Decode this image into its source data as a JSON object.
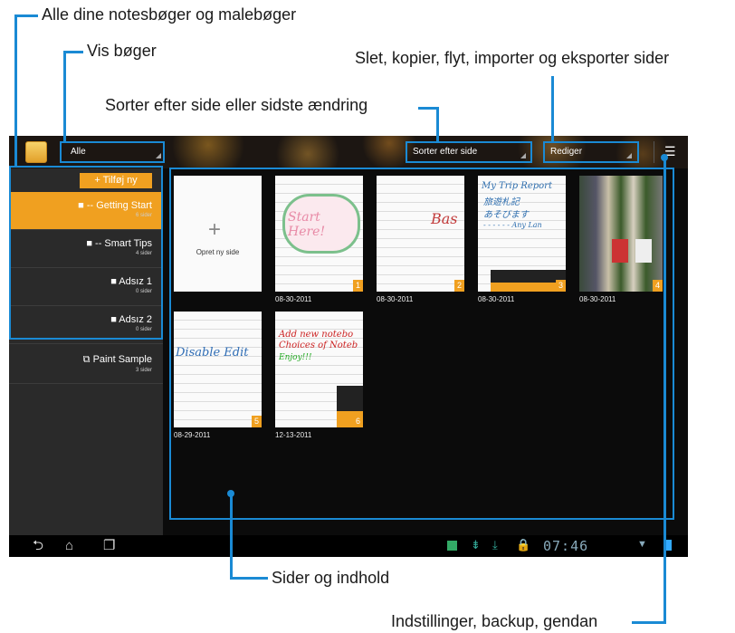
{
  "annotations": {
    "all_notebooks": "Alle dine notesbøger og malebøger",
    "view_books": "Vis bøger",
    "sort": "Sorter efter side eller sidste ændring",
    "edit_pages": "Slet, kopier, flyt, importer og eksporter sider",
    "pages_content": "Sider og indhold",
    "settings": "Indstillinger, backup, gendan"
  },
  "topbar": {
    "filter": "Alle",
    "sort": "Sorter efter side",
    "edit": "Rediger",
    "menu_icon": "menu-icon"
  },
  "sidebar": {
    "add_label": "+ Tilføj ny",
    "notebooks": [
      {
        "title": "■ -- Getting Start",
        "sub": "6 sider"
      },
      {
        "title": "■ -- Smart Tips",
        "sub": "4 sider"
      },
      {
        "title": "■ Adsız 1",
        "sub": "0 sider"
      },
      {
        "title": "■ Adsız 2",
        "sub": "0 sider"
      },
      {
        "title": "⧉ Paint Sample",
        "sub": "3 sider"
      }
    ]
  },
  "pages": {
    "new_page": "Opret ny side",
    "items": [
      {
        "num": "1",
        "date": "08-30-2011",
        "text": "Start Here!"
      },
      {
        "num": "2",
        "date": "08-30-2011",
        "text": "Bas"
      },
      {
        "num": "3",
        "date": "08-30-2011",
        "text": "My Trip Report"
      },
      {
        "num": "4",
        "date": "08-30-2011",
        "text": ""
      },
      {
        "num": "5",
        "date": "08-29-2011",
        "text": "Disable Edit"
      },
      {
        "num": "6",
        "date": "12-13-2011",
        "text": "Add new notebo"
      }
    ],
    "page3_sub": "旅遊札記",
    "page3_sub2": "あそびます",
    "page3_sub3": "- - - - - - Any Lan",
    "page6_sub": "Choices of Noteb",
    "page6_sub2": "Enjoy!!!"
  },
  "navbar": {
    "back": "⮌",
    "home": "⌂",
    "recent": "❐",
    "clock": "07:46"
  },
  "colors": {
    "accent": "#f0a020",
    "highlight": "#1a8ad4"
  }
}
